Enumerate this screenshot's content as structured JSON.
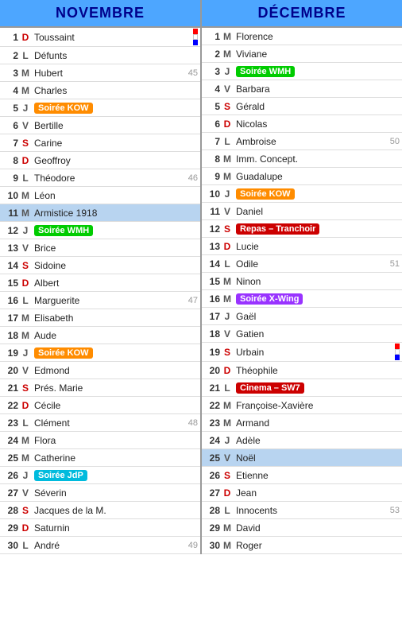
{
  "novembre": {
    "header": "NOVEMBRE",
    "days": [
      {
        "num": "1",
        "letter": "D",
        "name": "Toussaint",
        "extra": "",
        "badge": null,
        "highlight": false,
        "flags": true
      },
      {
        "num": "2",
        "letter": "L",
        "name": "Défunts",
        "extra": "",
        "badge": null,
        "highlight": false
      },
      {
        "num": "3",
        "letter": "M",
        "name": "Hubert",
        "extra": "45",
        "badge": null,
        "highlight": false
      },
      {
        "num": "4",
        "letter": "M",
        "name": "Charles",
        "extra": "",
        "badge": null,
        "highlight": false
      },
      {
        "num": "5",
        "letter": "J",
        "name": "",
        "extra": "",
        "badge": {
          "text": "Soirée KOW",
          "type": "orange"
        },
        "highlight": false
      },
      {
        "num": "6",
        "letter": "V",
        "name": "Bertille",
        "extra": "",
        "badge": null,
        "highlight": false
      },
      {
        "num": "7",
        "letter": "S",
        "name": "Carine",
        "extra": "",
        "badge": null,
        "highlight": false
      },
      {
        "num": "8",
        "letter": "D",
        "name": "Geoffroy",
        "extra": "",
        "badge": null,
        "highlight": false
      },
      {
        "num": "9",
        "letter": "L",
        "name": "Théodore",
        "extra": "46",
        "badge": null,
        "highlight": false
      },
      {
        "num": "10",
        "letter": "M",
        "name": "Léon",
        "extra": "",
        "badge": null,
        "highlight": false
      },
      {
        "num": "11",
        "letter": "M",
        "name": "Armistice 1918",
        "extra": "",
        "badge": null,
        "highlight": true
      },
      {
        "num": "12",
        "letter": "J",
        "name": "",
        "extra": "",
        "badge": {
          "text": "Soirée WMH",
          "type": "green"
        },
        "highlight": false
      },
      {
        "num": "13",
        "letter": "V",
        "name": "Brice",
        "extra": "",
        "badge": null,
        "highlight": false
      },
      {
        "num": "14",
        "letter": "S",
        "name": "Sidoine",
        "extra": "",
        "badge": null,
        "highlight": false
      },
      {
        "num": "15",
        "letter": "D",
        "name": "Albert",
        "extra": "",
        "badge": null,
        "highlight": false
      },
      {
        "num": "16",
        "letter": "L",
        "name": "Marguerite",
        "extra": "47",
        "badge": null,
        "highlight": false
      },
      {
        "num": "17",
        "letter": "M",
        "name": "Elisabeth",
        "extra": "",
        "badge": null,
        "highlight": false
      },
      {
        "num": "18",
        "letter": "M",
        "name": "Aude",
        "extra": "",
        "badge": null,
        "highlight": false
      },
      {
        "num": "19",
        "letter": "J",
        "name": "",
        "extra": "",
        "badge": {
          "text": "Soirée KOW",
          "type": "orange"
        },
        "highlight": false
      },
      {
        "num": "20",
        "letter": "V",
        "name": "Edmond",
        "extra": "",
        "badge": null,
        "highlight": false
      },
      {
        "num": "21",
        "letter": "S",
        "name": "Prés. Marie",
        "extra": "",
        "badge": null,
        "highlight": false
      },
      {
        "num": "22",
        "letter": "D",
        "name": "Cécile",
        "extra": "",
        "badge": null,
        "highlight": false
      },
      {
        "num": "23",
        "letter": "L",
        "name": "Clément",
        "extra": "48",
        "badge": null,
        "highlight": false
      },
      {
        "num": "24",
        "letter": "M",
        "name": "Flora",
        "extra": "",
        "badge": null,
        "highlight": false
      },
      {
        "num": "25",
        "letter": "M",
        "name": "Catherine",
        "extra": "",
        "badge": null,
        "highlight": false
      },
      {
        "num": "26",
        "letter": "J",
        "name": "",
        "extra": "",
        "badge": {
          "text": "Soirée JdP",
          "type": "cyan"
        },
        "highlight": false
      },
      {
        "num": "27",
        "letter": "V",
        "name": "Séverin",
        "extra": "",
        "badge": null,
        "highlight": false
      },
      {
        "num": "28",
        "letter": "S",
        "name": "Jacques de la M.",
        "extra": "",
        "badge": null,
        "highlight": false
      },
      {
        "num": "29",
        "letter": "D",
        "name": "Saturnin",
        "extra": "",
        "badge": null,
        "highlight": false
      },
      {
        "num": "30",
        "letter": "L",
        "name": "André",
        "extra": "49",
        "badge": null,
        "highlight": false
      }
    ]
  },
  "decembre": {
    "header": "DÉCEMBRE",
    "days": [
      {
        "num": "1",
        "letter": "M",
        "name": "Florence",
        "extra": "",
        "badge": null,
        "highlight": false
      },
      {
        "num": "2",
        "letter": "M",
        "name": "Viviane",
        "extra": "",
        "badge": null,
        "highlight": false
      },
      {
        "num": "3",
        "letter": "J",
        "name": "",
        "extra": "",
        "badge": {
          "text": "Soirée WMH",
          "type": "green"
        },
        "highlight": false
      },
      {
        "num": "4",
        "letter": "V",
        "name": "Barbara",
        "extra": "",
        "badge": null,
        "highlight": false
      },
      {
        "num": "5",
        "letter": "S",
        "name": "Gérald",
        "extra": "",
        "badge": null,
        "highlight": false
      },
      {
        "num": "6",
        "letter": "D",
        "name": "Nicolas",
        "extra": "",
        "badge": null,
        "highlight": false
      },
      {
        "num": "7",
        "letter": "L",
        "name": "Ambroise",
        "extra": "50",
        "badge": null,
        "highlight": false
      },
      {
        "num": "8",
        "letter": "M",
        "name": "Imm. Concept.",
        "extra": "",
        "badge": null,
        "highlight": false
      },
      {
        "num": "9",
        "letter": "M",
        "name": "Guadalupe",
        "extra": "",
        "badge": null,
        "highlight": false
      },
      {
        "num": "10",
        "letter": "J",
        "name": "",
        "extra": "",
        "badge": {
          "text": "Soirée KOW",
          "type": "orange"
        },
        "highlight": false
      },
      {
        "num": "11",
        "letter": "V",
        "name": "Daniel",
        "extra": "",
        "badge": null,
        "highlight": false
      },
      {
        "num": "12",
        "letter": "S",
        "name": "",
        "extra": "",
        "badge": {
          "text": "Repas – Tranchoir",
          "type": "red"
        },
        "highlight": false
      },
      {
        "num": "13",
        "letter": "D",
        "name": "Lucie",
        "extra": "",
        "badge": null,
        "highlight": false
      },
      {
        "num": "14",
        "letter": "L",
        "name": "Odile",
        "extra": "51",
        "badge": null,
        "highlight": false
      },
      {
        "num": "15",
        "letter": "M",
        "name": "Ninon",
        "extra": "",
        "badge": null,
        "highlight": false
      },
      {
        "num": "16",
        "letter": "M",
        "name": "",
        "extra": "",
        "badge": {
          "text": "Soirée X-Wing",
          "type": "purple"
        },
        "highlight": false
      },
      {
        "num": "17",
        "letter": "J",
        "name": "Gaël",
        "extra": "",
        "badge": null,
        "highlight": false
      },
      {
        "num": "18",
        "letter": "V",
        "name": "Gatien",
        "extra": "",
        "badge": null,
        "highlight": false
      },
      {
        "num": "19",
        "letter": "S",
        "name": "Urbain",
        "extra": "",
        "badge": null,
        "highlight": false,
        "flags": true
      },
      {
        "num": "20",
        "letter": "D",
        "name": "Théophile",
        "extra": "",
        "badge": null,
        "highlight": false
      },
      {
        "num": "21",
        "letter": "L",
        "name": "",
        "extra": "",
        "badge": {
          "text": "Cinema – SW7",
          "type": "red"
        },
        "highlight": false
      },
      {
        "num": "22",
        "letter": "M",
        "name": "Françoise-Xavière",
        "extra": "",
        "badge": null,
        "highlight": false
      },
      {
        "num": "23",
        "letter": "M",
        "name": "Armand",
        "extra": "",
        "badge": null,
        "highlight": false
      },
      {
        "num": "24",
        "letter": "J",
        "name": "Adèle",
        "extra": "",
        "badge": null,
        "highlight": false
      },
      {
        "num": "25",
        "letter": "V",
        "name": "Noël",
        "extra": "",
        "badge": null,
        "highlight": true
      },
      {
        "num": "26",
        "letter": "S",
        "name": "Etienne",
        "extra": "",
        "badge": null,
        "highlight": false
      },
      {
        "num": "27",
        "letter": "D",
        "name": "Jean",
        "extra": "",
        "badge": null,
        "highlight": false
      },
      {
        "num": "28",
        "letter": "L",
        "name": "Innocents",
        "extra": "53",
        "badge": null,
        "highlight": false
      },
      {
        "num": "29",
        "letter": "M",
        "name": "David",
        "extra": "",
        "badge": null,
        "highlight": false
      },
      {
        "num": "30",
        "letter": "M",
        "name": "Roger",
        "extra": "",
        "badge": null,
        "highlight": false
      }
    ]
  },
  "badges": {
    "orange": "badge-orange",
    "green": "badge-green",
    "red": "badge-red",
    "purple": "badge-purple",
    "cyan": "badge-cyan"
  }
}
